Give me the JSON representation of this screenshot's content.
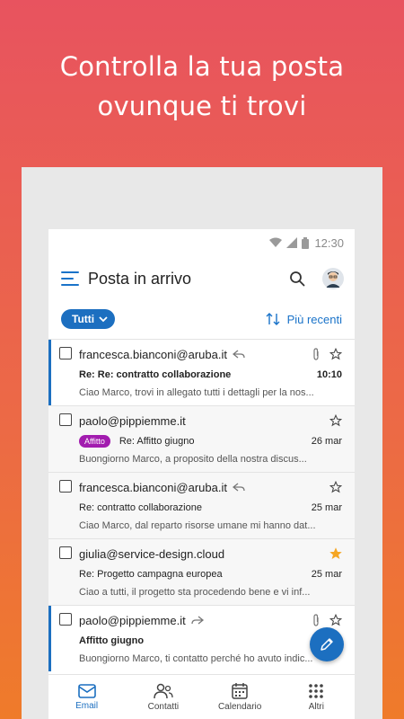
{
  "headline": {
    "line1": "Controlla la tua posta",
    "line2": "ovunque ti trovi"
  },
  "status_bar": {
    "time": "12:30"
  },
  "app_bar": {
    "title": "Posta in arrivo"
  },
  "filter": {
    "chip_label": "Tutti",
    "sort_label": "Più recenti"
  },
  "messages": [
    {
      "sender": "francesca.bianconi@aruba.it",
      "subject": "Re: Re: contratto collaborazione",
      "date": "10:10",
      "preview": "Ciao Marco, trovi in allegato tutti i dettagli per la nos..."
    },
    {
      "sender": "paolo@pippiemme.it",
      "tag": "Affitto",
      "subject": "Re: Affitto giugno",
      "date": "26 mar",
      "preview": "Buongiorno Marco, a proposito della nostra discus..."
    },
    {
      "sender": "francesca.bianconi@aruba.it",
      "subject": "Re: contratto collaborazione",
      "date": "25 mar",
      "preview": "Ciao Marco, dal reparto risorse umane mi hanno dat..."
    },
    {
      "sender": "giulia@service-design.cloud",
      "subject": "Re: Progetto campagna europea",
      "date": "25 mar",
      "preview": "Ciao a tutti, il progetto sta procedendo bene e vi inf..."
    },
    {
      "sender": "paolo@pippiemme.it",
      "subject": "Affitto giugno",
      "date": "",
      "preview": "Buongiorno Marco, ti contatto perché ho avuto indic..."
    }
  ],
  "bottom_nav": [
    {
      "label": "Email"
    },
    {
      "label": "Contatti"
    },
    {
      "label": "Calendario"
    },
    {
      "label": "Altri"
    }
  ],
  "colors": {
    "accent": "#1c6fc0",
    "tag": "#a21caf",
    "star": "#f5a623"
  }
}
